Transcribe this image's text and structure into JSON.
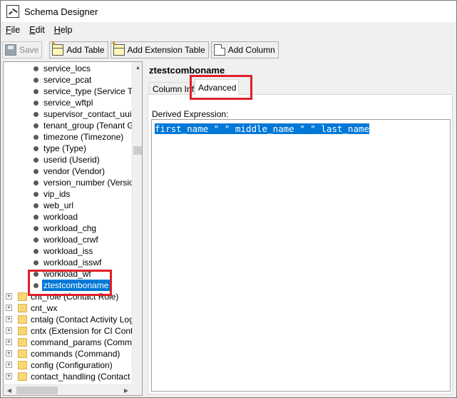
{
  "window": {
    "title": "Schema Designer"
  },
  "menu": {
    "file": "ile",
    "file_u": "F",
    "edit": "dit",
    "edit_u": "E",
    "help": "elp",
    "help_u": "H"
  },
  "toolbar": {
    "save": "Save",
    "add_table": "Add Table",
    "add_extension_table": "Add Extension Table",
    "add_column": "Add Column"
  },
  "tree": {
    "columns": [
      "service_locs",
      "service_pcat",
      "service_type (Service Typ",
      "service_wftpl",
      "supervisor_contact_uuid (",
      "tenant_group (Tenant Gro",
      "timezone (Timezone)",
      "type (Type)",
      "userid (Userid)",
      "vendor (Vendor)",
      "version_number (Version N",
      "vip_ids",
      "web_url",
      "workload",
      "workload_chg",
      "workload_crwf",
      "workload_iss",
      "workload_isswf",
      "workload_wf",
      "ztestcomboname"
    ],
    "selected_index": 19,
    "tables": [
      "cnt_role (Contact Role)",
      "cnt_wx",
      "cntalg (Contact Activity Log)",
      "cntx (Extension for CI Contac",
      "command_params (Command",
      "commands (Command)",
      "config (Configuration)",
      "contact_handling (Contact Ha"
    ]
  },
  "detail": {
    "entity_name": "ztestcomboname",
    "tabs": [
      "Column Info",
      "Advanced"
    ],
    "active_tab": "Advanced",
    "derived_expression_label": "Derived Expression:",
    "derived_expression_value": "first_name \" \" middle_name \" \" last_name"
  },
  "colors": {
    "selection": "#0078d7",
    "annotation": "#e0202a"
  }
}
